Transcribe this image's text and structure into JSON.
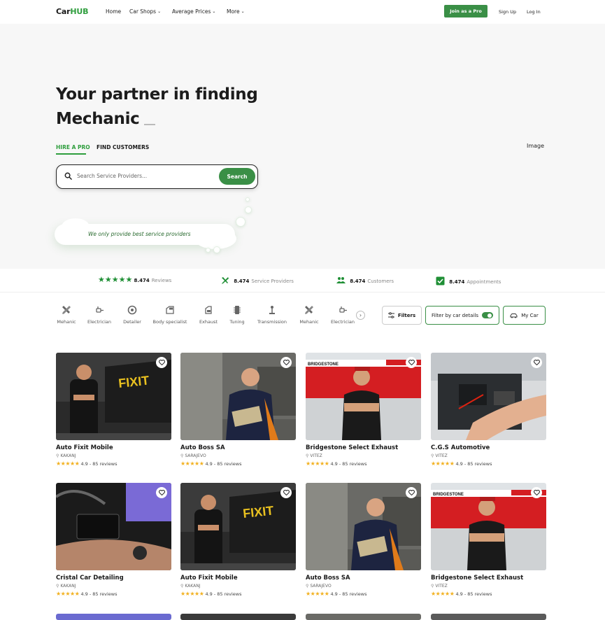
{
  "nav": {
    "logo_prefix": "Car",
    "logo_suffix": "HUB",
    "links": [
      {
        "label": "Home",
        "has_menu": false
      },
      {
        "label": "Car Shops",
        "has_menu": true
      },
      {
        "label": "Average Prices",
        "has_menu": true
      },
      {
        "label": "More",
        "has_menu": true
      }
    ],
    "join_label": "Join as a Pro",
    "signup_label": "Sign Up",
    "login_label": "Log In"
  },
  "hero": {
    "title_line1": "Your partner in finding",
    "title_line2": "Mechanic",
    "tabs": [
      "HIRE A PRO",
      "FIND CUSTOMERS"
    ],
    "image_label": "Image",
    "search_placeholder": "Search Service Providers...",
    "search_button": "Search",
    "cloud_text": "We only provide best service providers"
  },
  "stats": [
    {
      "value": "8.474",
      "label": "Reviews",
      "icon": "five-stars-icon"
    },
    {
      "value": "8.474",
      "label": "Service Providers",
      "icon": "tools-icon"
    },
    {
      "value": "8.474",
      "label": "Customers",
      "icon": "users-icon"
    },
    {
      "value": "8.474",
      "label": "Appointments",
      "icon": "checkbox-icon"
    }
  ],
  "categories": [
    {
      "label": "Mehanic",
      "icon": "wrench-screwdriver-icon"
    },
    {
      "label": "Electrician",
      "icon": "plug-icon"
    },
    {
      "label": "Detailer",
      "icon": "wheel-icon"
    },
    {
      "label": "Body specialist",
      "icon": "car-door-icon"
    },
    {
      "label": "Exhaust",
      "icon": "exhaust-icon"
    },
    {
      "label": "Tuning",
      "icon": "chip-icon"
    },
    {
      "label": "Transmission",
      "icon": "gear-shift-icon"
    },
    {
      "label": "Mehanic",
      "icon": "wrench-screwdriver-icon"
    },
    {
      "label": "Electrician",
      "icon": "plug-icon"
    }
  ],
  "toolbar": {
    "filters_label": "Filters",
    "filter_by_car_label": "Filter by car details",
    "my_car_label": "My Car"
  },
  "cards": [
    {
      "name": "Auto Fixit Mobile",
      "location": "KAKANJ",
      "rating": "4.9 - 85 reviews",
      "photo": "van-mechanic"
    },
    {
      "name": "Auto Boss SA",
      "location": "SARAJEVO",
      "rating": "4.9 - 85 reviews",
      "photo": "garage-mechanic"
    },
    {
      "name": "Bridgestone Select Exhaust",
      "location": "VITEZ",
      "rating": "4.9 - 85 reviews",
      "photo": "tyre-shop"
    },
    {
      "name": "C.G.S Automotive",
      "location": "VITEZ",
      "rating": "4.9 - 85 reviews",
      "photo": "engine-bay"
    },
    {
      "name": "Cristal Car Detailing",
      "location": "KAKANJ",
      "rating": "4.9 - 85 reviews",
      "photo": "car-interior"
    },
    {
      "name": "Auto Fixit Mobile",
      "location": "KAKANJ",
      "rating": "4.9 - 85 reviews",
      "photo": "van-mechanic"
    },
    {
      "name": "Auto Boss SA",
      "location": "SARAJEVO",
      "rating": "4.9 - 85 reviews",
      "photo": "garage-mechanic"
    },
    {
      "name": "Bridgestone Select Exhaust",
      "location": "VITEZ",
      "rating": "4.9 - 85 reviews",
      "photo": "tyre-shop"
    }
  ],
  "colors": {
    "brand_green": "#3a8f46",
    "accent_green": "#2f9e3e",
    "star_gold": "#f2b01e"
  }
}
